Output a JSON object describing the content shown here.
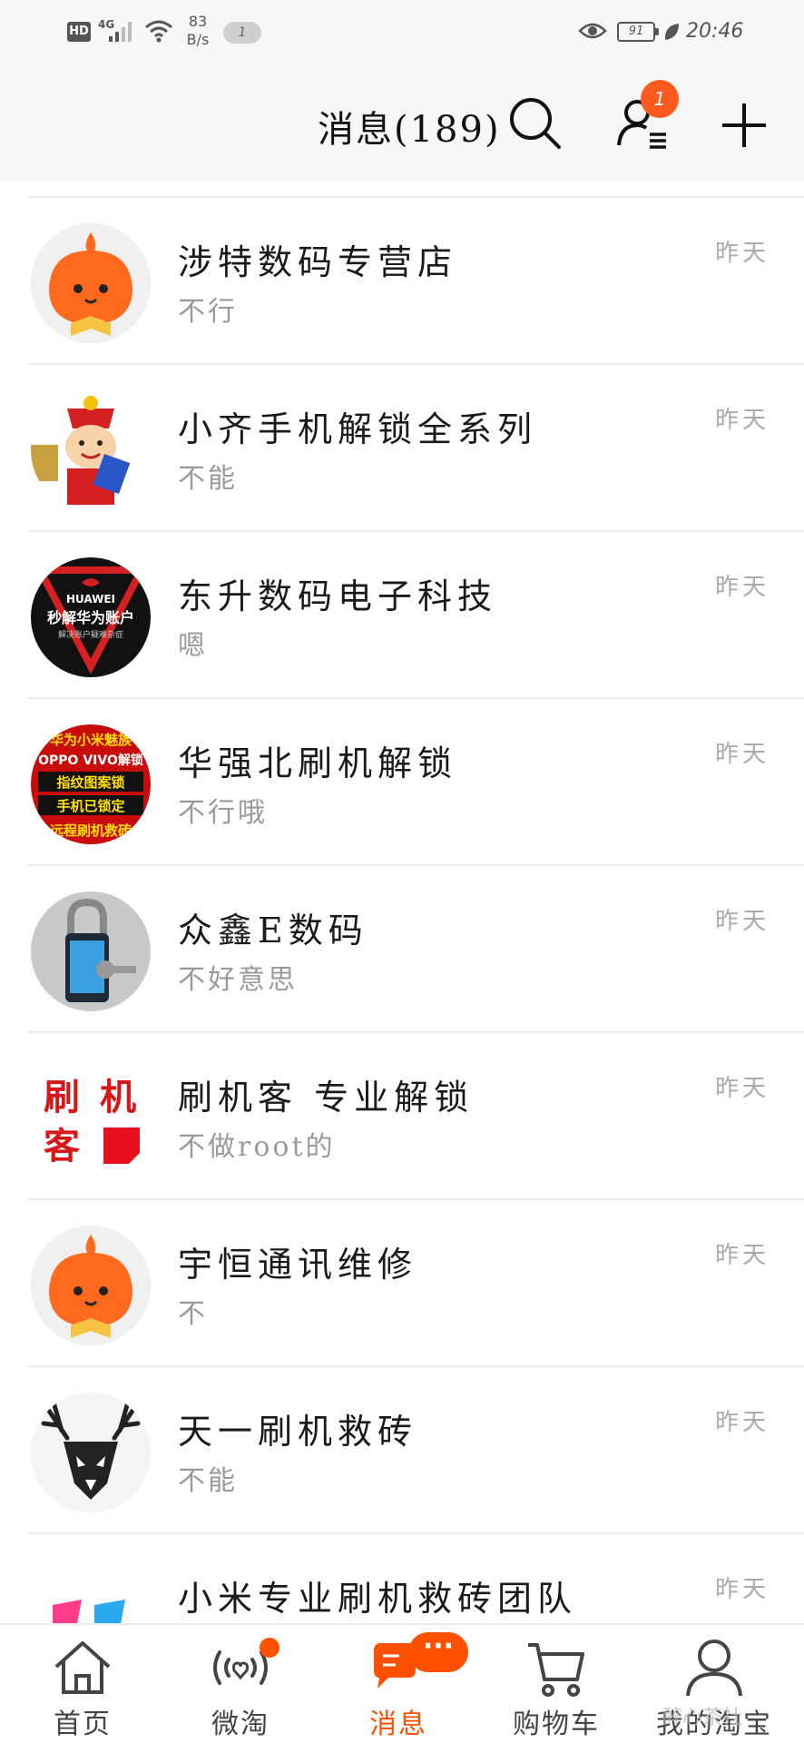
{
  "status_bar": {
    "network_type": "HD",
    "cell": "4G",
    "speed_value": "83",
    "speed_unit": "B/s",
    "notification_count": "1",
    "battery": "91",
    "time": "20:46"
  },
  "header": {
    "title": "消息(189)",
    "contacts_badge": "1",
    "icons": {
      "search": "search-icon",
      "contacts": "contacts-icon",
      "add": "plus-icon"
    }
  },
  "conversations": [
    {
      "name": "涉特数码专营店",
      "message": "不行",
      "time": "昨天",
      "avatar": "taobao-mascot"
    },
    {
      "name": "小齐手机解锁全系列",
      "message": "不能",
      "time": "昨天",
      "avatar": "fortune-god-cartoon"
    },
    {
      "name": "东升数码电子科技",
      "message": "嗯",
      "time": "昨天",
      "avatar": "huawei-unlock-logo",
      "avatar_text": [
        "HUAWEI",
        "秒解华为账户",
        "解决账户疑难杂症"
      ]
    },
    {
      "name": "华强北刷机解锁",
      "message": "不行哦",
      "time": "昨天",
      "avatar": "unlock-banner",
      "avatar_text": [
        "华为小米魅族",
        "OPPO VIVO解锁",
        "指纹图案锁",
        "手机已锁定",
        "远程刷机救砖"
      ]
    },
    {
      "name": "众鑫E数码",
      "message": "不好意思",
      "time": "昨天",
      "avatar": "phone-lock-key"
    },
    {
      "name": "刷机客 专业解锁",
      "message": "不做root的",
      "time": "昨天",
      "avatar": "shuajike-logo",
      "avatar_text": [
        "刷",
        "机",
        "客"
      ]
    },
    {
      "name": "宇恒通讯维修",
      "message": "不",
      "time": "昨天",
      "avatar": "taobao-mascot"
    },
    {
      "name": "天一刷机救砖",
      "message": "不能",
      "time": "昨天",
      "avatar": "deer-head"
    },
    {
      "name": "小米专业刷机救砖团队",
      "message": "",
      "time": "昨天",
      "avatar": "colorful-logo"
    }
  ],
  "bottom_nav": {
    "items": [
      {
        "label": "首页",
        "icon": "home-icon",
        "active": false
      },
      {
        "label": "微淘",
        "icon": "broadcast-icon",
        "active": false
      },
      {
        "label": "消息",
        "icon": "message-icon",
        "active": true,
        "badge": "···"
      },
      {
        "label": "购物车",
        "icon": "cart-icon",
        "active": false
      },
      {
        "label": "我的淘宝",
        "icon": "profile-icon",
        "active": false
      }
    ],
    "watermark": "醉心茶社"
  },
  "colors": {
    "accent": "#ff5000",
    "mascot": "#ff6a1f",
    "divider": "#ececec"
  }
}
